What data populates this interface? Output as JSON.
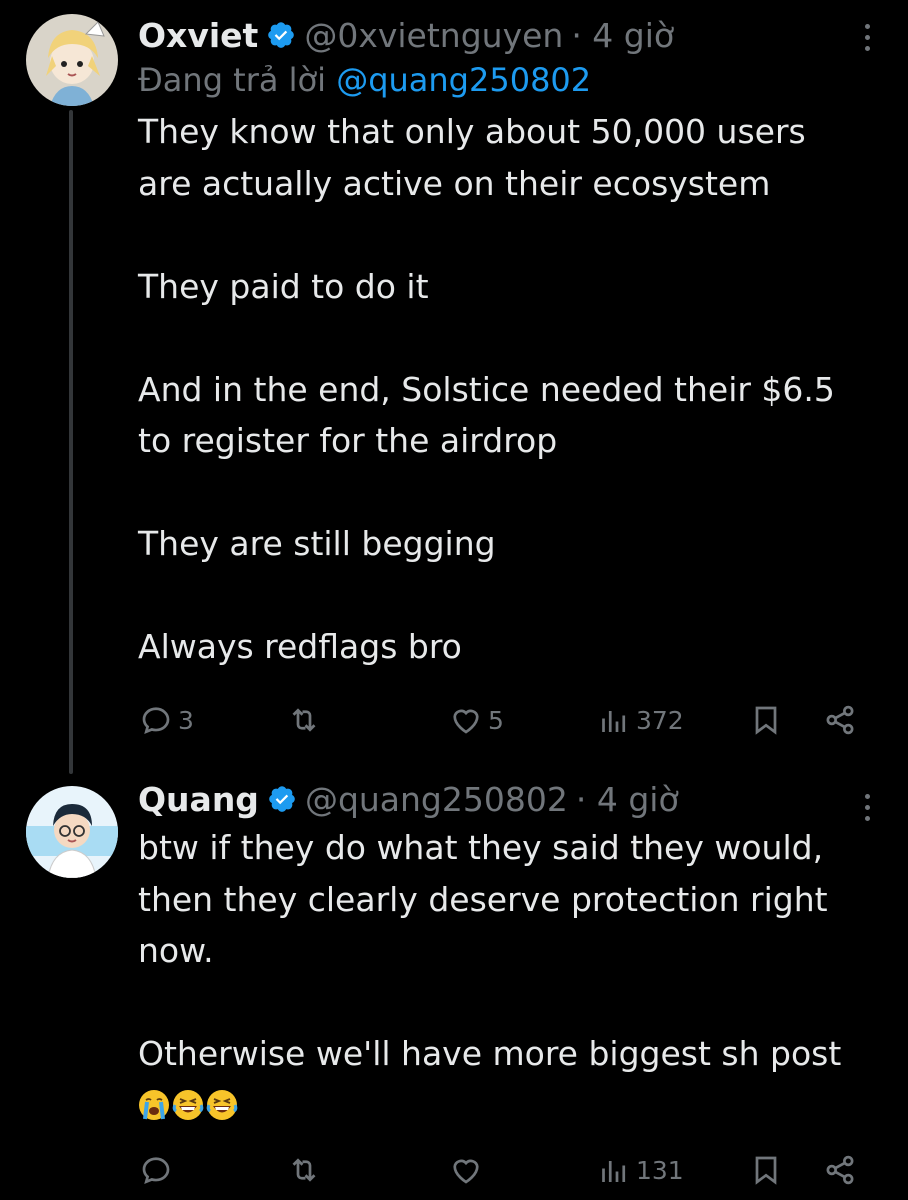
{
  "tweets": [
    {
      "author": {
        "name": "Oxviet",
        "handle": "@0xvietnguyen",
        "time": "· 4 giờ",
        "verified": true
      },
      "replying": {
        "prefix": "Đang trả lời",
        "mention": "@quang250802"
      },
      "body": [
        "They know that only about 50,000 users",
        "are actually active on their ecosystem",
        "",
        "They paid to do it",
        "",
        "And in the end, Solstice needed their $6.5",
        "to register for the airdrop",
        "",
        "They are still begging",
        "",
        "Always redflags bro"
      ],
      "actions": {
        "replies": "3",
        "retweets": "",
        "likes": "5",
        "views": "372"
      }
    },
    {
      "author": {
        "name": "Quang",
        "handle": "@quang250802",
        "time": "· 4 giờ",
        "verified": true
      },
      "body": [
        "btw if they do what they said they would,",
        "then they clearly deserve protection right",
        "now.",
        "",
        "Otherwise we'll have more biggest sh post"
      ],
      "emoji": [
        "loudly-crying-face",
        "grinning-squinting-face",
        "grinning-squinting-face"
      ],
      "actions": {
        "replies": "",
        "retweets": "",
        "likes": "",
        "views": "131"
      }
    }
  ],
  "colors": {
    "background": "#000000",
    "text": "#e7e9ea",
    "muted": "#71767b",
    "link": "#1d9bf0",
    "verified": "#1d9bf0"
  }
}
